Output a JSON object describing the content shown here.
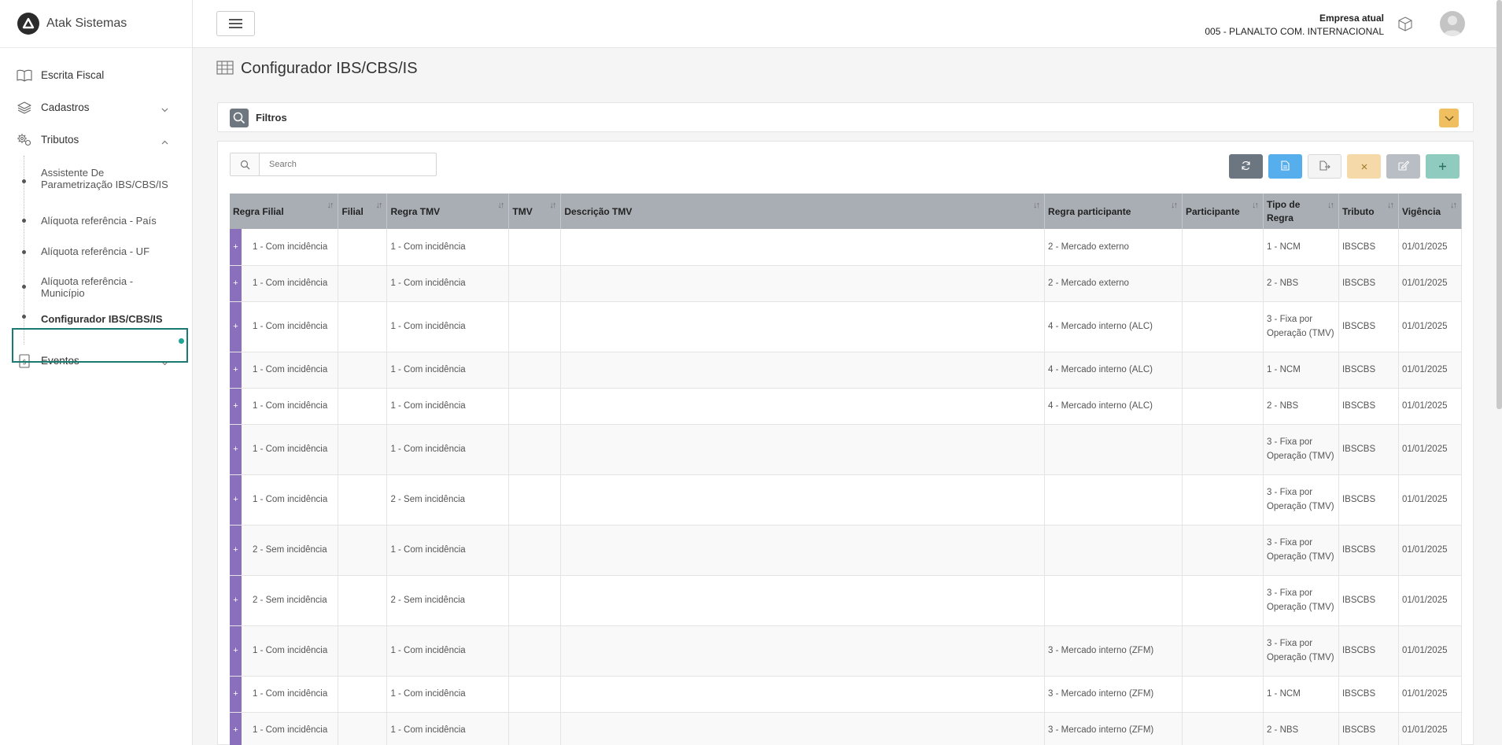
{
  "app": {
    "name": "Atak Sistemas"
  },
  "sidebar": {
    "items": [
      {
        "label": "Escrita Fiscal",
        "icon": "book-icon"
      },
      {
        "label": "Cadastros",
        "icon": "layers-icon",
        "chevron": "down"
      },
      {
        "label": "Tributos",
        "icon": "gears-icon",
        "chevron": "up"
      }
    ],
    "tributos_sub": [
      "Assistente De Parametrização IBS/CBS/IS",
      "Alíquota referência - País",
      "Alíquota referência - UF",
      "Alíquota referência - Município",
      "Configurador IBS/CBS/IS"
    ],
    "eventos": {
      "label": "Eventos",
      "icon": "receipt-icon",
      "chevron": "down"
    }
  },
  "header": {
    "company_label": "Empresa atual",
    "company_value": "005 - PLANALTO COM. INTERNACIONAL"
  },
  "page": {
    "title": "Configurador IBS/CBS/IS"
  },
  "filters": {
    "label": "Filtros"
  },
  "search": {
    "placeholder": "Search"
  },
  "table": {
    "columns": [
      "Regra Filial",
      "Filial",
      "Regra TMV",
      "TMV",
      "Descrição TMV",
      "Regra participante",
      "Participante",
      "Tipo de Regra",
      "Tributo",
      "Vigência"
    ],
    "rows": [
      [
        "1 - Com incidência",
        "",
        "1 - Com incidência",
        "",
        "",
        "2 - Mercado externo",
        "",
        "1 - NCM",
        "IBSCBS",
        "01/01/2025"
      ],
      [
        "1 - Com incidência",
        "",
        "1 - Com incidência",
        "",
        "",
        "2 - Mercado externo",
        "",
        "2 - NBS",
        "IBSCBS",
        "01/01/2025"
      ],
      [
        "1 - Com incidência",
        "",
        "1 - Com incidência",
        "",
        "",
        "4 - Mercado interno (ALC)",
        "",
        "3 - Fixa por Operação (TMV)",
        "IBSCBS",
        "01/01/2025"
      ],
      [
        "1 - Com incidência",
        "",
        "1 - Com incidência",
        "",
        "",
        "4 - Mercado interno (ALC)",
        "",
        "1 - NCM",
        "IBSCBS",
        "01/01/2025"
      ],
      [
        "1 - Com incidência",
        "",
        "1 - Com incidência",
        "",
        "",
        "4 - Mercado interno (ALC)",
        "",
        "2 - NBS",
        "IBSCBS",
        "01/01/2025"
      ],
      [
        "1 - Com incidência",
        "",
        "1 - Com incidência",
        "",
        "",
        "",
        "",
        "3 - Fixa por Operação (TMV)",
        "IBSCBS",
        "01/01/2025"
      ],
      [
        "1 - Com incidência",
        "",
        "2 - Sem incidência",
        "",
        "",
        "",
        "",
        "3 - Fixa por Operação (TMV)",
        "IBSCBS",
        "01/01/2025"
      ],
      [
        "2 - Sem incidência",
        "",
        "1 - Com incidência",
        "",
        "",
        "",
        "",
        "3 - Fixa por Operação (TMV)",
        "IBSCBS",
        "01/01/2025"
      ],
      [
        "2 - Sem incidência",
        "",
        "2 - Sem incidência",
        "",
        "",
        "",
        "",
        "3 - Fixa por Operação (TMV)",
        "IBSCBS",
        "01/01/2025"
      ],
      [
        "1 - Com incidência",
        "",
        "1 - Com incidência",
        "",
        "",
        "3 - Mercado interno (ZFM)",
        "",
        "3 - Fixa por Operação (TMV)",
        "IBSCBS",
        "01/01/2025"
      ],
      [
        "1 - Com incidência",
        "",
        "1 - Com incidência",
        "",
        "",
        "3 - Mercado interno (ZFM)",
        "",
        "1 - NCM",
        "IBSCBS",
        "01/01/2025"
      ],
      [
        "1 - Com incidência",
        "",
        "1 - Com incidência",
        "",
        "",
        "3 - Mercado interno (ZFM)",
        "",
        "2 - NBS",
        "IBSCBS",
        "01/01/2025"
      ]
    ]
  },
  "colors": {
    "expand": "#8a6fbd",
    "header": "#a9aeb4",
    "accent": "#1a7a72"
  }
}
